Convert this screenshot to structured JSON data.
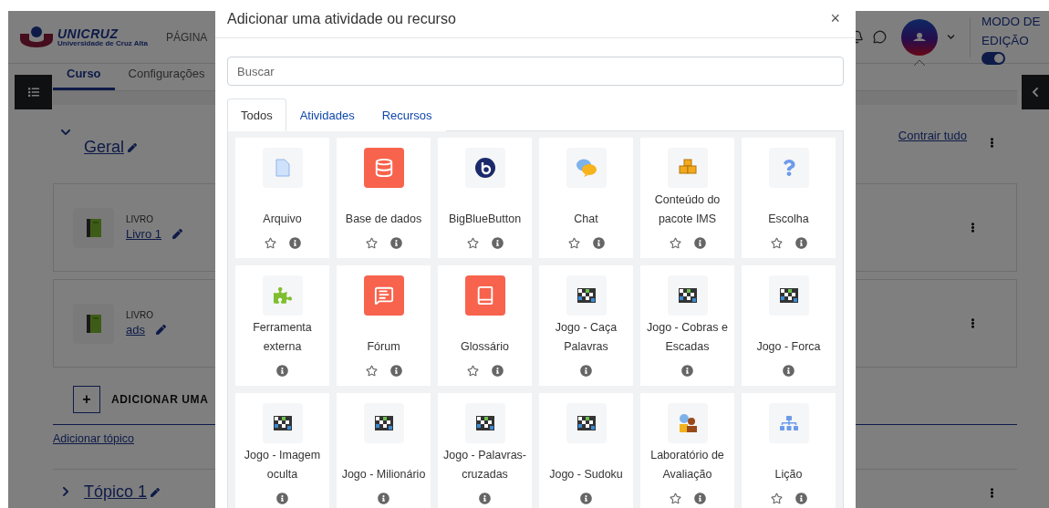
{
  "header": {
    "logo": {
      "name": "UNICRUZ",
      "subtitle": "Universidade de Cruz Alta"
    },
    "nav_item": "PÁGINA",
    "edit_mode": {
      "label_lines": [
        "MODO DE",
        "EDIÇÃO"
      ],
      "on": true
    }
  },
  "course_tabs": [
    {
      "label": "Curso",
      "selected": true
    },
    {
      "label": "Configurações",
      "selected": false
    }
  ],
  "section": {
    "title": "Geral",
    "expanded": true,
    "collapse_link": "Contrair tudo",
    "activities": [
      {
        "type_label": "LIVRO",
        "name": "Livro 1"
      },
      {
        "type_label": "LIVRO",
        "name": "ads"
      }
    ],
    "add_activity": "+",
    "add_activity_label": "ADICIONAR UMA"
  },
  "add_topic": "Adicionar tópico",
  "next_section": {
    "title": "Tópico 1",
    "expanded": false
  },
  "modal": {
    "title": "Adicionar uma atividade ou recurso",
    "close": "×",
    "search": {
      "placeholder": "Buscar"
    },
    "tabs": [
      {
        "label": "Todos",
        "selected": true
      },
      {
        "label": "Atividades",
        "selected": false
      },
      {
        "label": "Recursos",
        "selected": false
      }
    ],
    "items": [
      {
        "label": "Arquivo",
        "kind": "file",
        "starred": false
      },
      {
        "label": "Base de dados",
        "kind": "database",
        "starred": false
      },
      {
        "label": "BigBlueButton",
        "kind": "conference",
        "starred": false
      },
      {
        "label": "Chat",
        "kind": "chat",
        "starred": false
      },
      {
        "label": "Conteúdo do pacote IMS",
        "kind": "package",
        "starred": false
      },
      {
        "label": "Escolha",
        "kind": "question",
        "starred": false
      },
      {
        "label": "Ferramenta externa",
        "kind": "puzzle"
      },
      {
        "label": "Fórum",
        "kind": "forum",
        "starred": false
      },
      {
        "label": "Glossário",
        "kind": "glossary",
        "starred": false
      },
      {
        "label": "Jogo - Caça Palavras",
        "kind": "game"
      },
      {
        "label": "Jogo - Cobras e Escadas",
        "kind": "game"
      },
      {
        "label": "Jogo - Forca",
        "kind": "game"
      },
      {
        "label": "Jogo - Imagem oculta",
        "kind": "game"
      },
      {
        "label": "Jogo - Milionário",
        "kind": "game"
      },
      {
        "label": "Jogo - Palavras-cruzadas",
        "kind": "game"
      },
      {
        "label": "Jogo - Sudoku",
        "kind": "game"
      },
      {
        "label": "Laboratório de Avaliação",
        "kind": "workshop",
        "starred": false
      },
      {
        "label": "Lição",
        "kind": "lesson",
        "starred": false
      }
    ]
  }
}
